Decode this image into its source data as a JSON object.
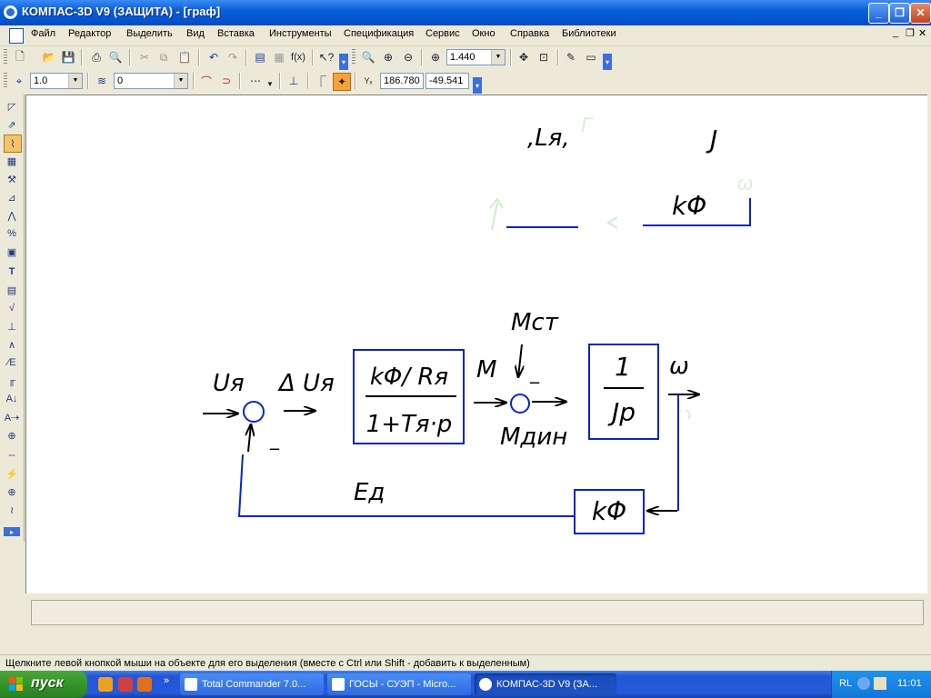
{
  "window": {
    "title": "КОМПАС-3D V9 (ЗАЩИТА) - [граф]",
    "buttons": {
      "minimize": "_",
      "restore": "❐",
      "close": "✕"
    }
  },
  "menu": {
    "items": [
      "Файл",
      "Редактор",
      "Выделить",
      "Вид",
      "Вставка",
      "Инструменты",
      "Спецификация",
      "Сервис",
      "Окно",
      "Справка",
      "Библиотеки"
    ],
    "doc_controls": {
      "minimize": "_",
      "restore": "❐",
      "close": "✕"
    }
  },
  "toolbar1": {
    "zoom_value": "1.440"
  },
  "toolbar2": {
    "step_value": "1.0",
    "layer_value": "0",
    "coord_label": "Yₓ",
    "coord_x": "186.780",
    "coord_y": "-49.541"
  },
  "diagram": {
    "u_ya": "Uя",
    "delta_u": "Δ Uя",
    "minus_1": "_",
    "block1_num": "kΦ/ Rя",
    "block1_den": "1+Tя·p",
    "m": "M",
    "m_st": "Mст",
    "minus_2": "_",
    "m_din": "Mдин",
    "block2_num": "1",
    "block2_den": "Jp",
    "omega": "ω",
    "feedback_block": "kΦ",
    "e_d": "Eд",
    "ghost_l": ",Lя,",
    "ghost_j": "J",
    "ghost_kf": "kΦ"
  },
  "status": {
    "hint": "Щелкните левой кнопкой мыши на объекте для его выделения (вместе с Ctrl или Shift - добавить к выделенным)"
  },
  "taskbar": {
    "start_label": "пуск",
    "tasks": [
      "Total Commander 7.0...",
      "ГОСЫ - СУЭП - Micro...",
      "КОМПАС-3D V9 (ЗА..."
    ],
    "tray_lang": "RL",
    "clock": "11:01"
  },
  "colors": {
    "accent_blue": "#0a24c8",
    "ghost_green": "#a8e0a8"
  }
}
